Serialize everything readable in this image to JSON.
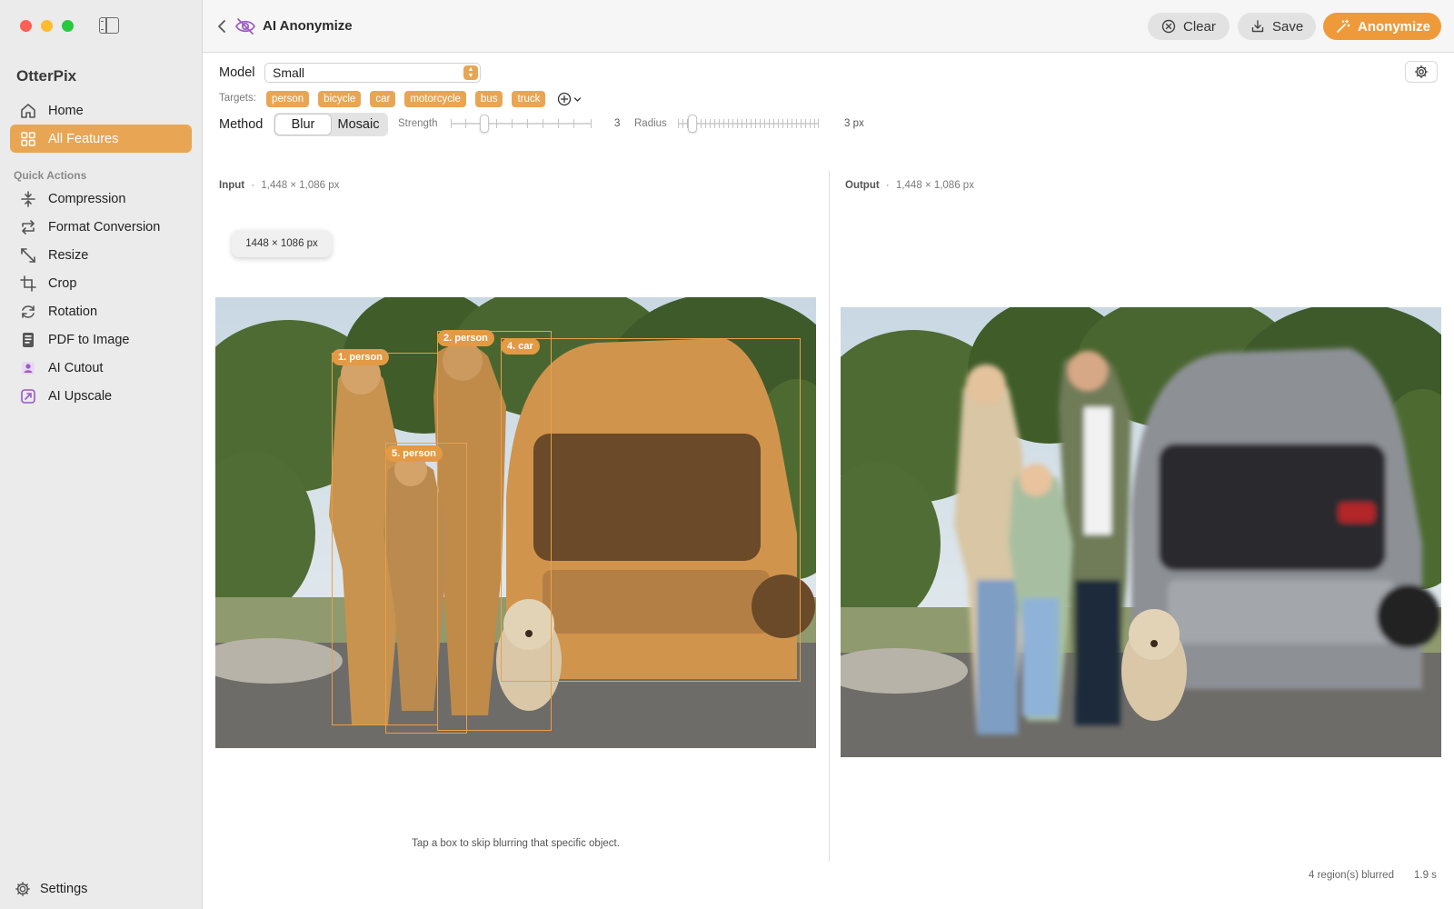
{
  "app": {
    "name": "OtterPix"
  },
  "sidebar": {
    "items": [
      {
        "label": "Home",
        "icon": "house-icon",
        "active": false
      },
      {
        "label": "All Features",
        "icon": "grid-icon",
        "active": true
      }
    ],
    "section_title": "Quick Actions",
    "quick_actions": [
      {
        "label": "Compression",
        "icon": "compression-icon"
      },
      {
        "label": "Format Conversion",
        "icon": "convert-icon"
      },
      {
        "label": "Resize",
        "icon": "resize-icon"
      },
      {
        "label": "Crop",
        "icon": "crop-icon"
      },
      {
        "label": "Rotation",
        "icon": "rotation-icon"
      },
      {
        "label": "PDF to Image",
        "icon": "pdf-icon"
      },
      {
        "label": "AI Cutout",
        "icon": "ai-cutout-icon"
      },
      {
        "label": "AI Upscale",
        "icon": "ai-upscale-icon"
      }
    ],
    "settings_label": "Settings"
  },
  "header": {
    "title": "AI Anonymize",
    "clear_label": "Clear",
    "save_label": "Save",
    "anonymize_label": "Anonymize"
  },
  "controls": {
    "model_label": "Model",
    "model_value": "Small",
    "targets_label": "Targets:",
    "targets": [
      "person",
      "bicycle",
      "car",
      "motorcycle",
      "bus",
      "truck"
    ],
    "method_label": "Method",
    "methods": [
      "Blur",
      "Mosaic"
    ],
    "selected_method": "Blur",
    "strength_label": "Strength",
    "strength_value": "3",
    "radius_label": "Radius",
    "radius_value": "3 px"
  },
  "input": {
    "label": "Input",
    "separator": "·",
    "dimensions": "1,448 × 1,086 px",
    "chip": "1448 × 1086 px",
    "boxes": [
      {
        "label": "1. person"
      },
      {
        "label": "2. person"
      },
      {
        "label": "4. car"
      },
      {
        "label": "5. person"
      }
    ],
    "hint": "Tap a box to skip blurring that specific object."
  },
  "output": {
    "label": "Output",
    "separator": "·",
    "dimensions": "1,448 × 1,086 px"
  },
  "status": {
    "regions": "4 region(s) blurred",
    "time": "1.9 s"
  },
  "colors": {
    "accent": "#e8a654",
    "anonymize_button": "#ef9a3a",
    "sidebar_bg": "#ebebeb"
  }
}
